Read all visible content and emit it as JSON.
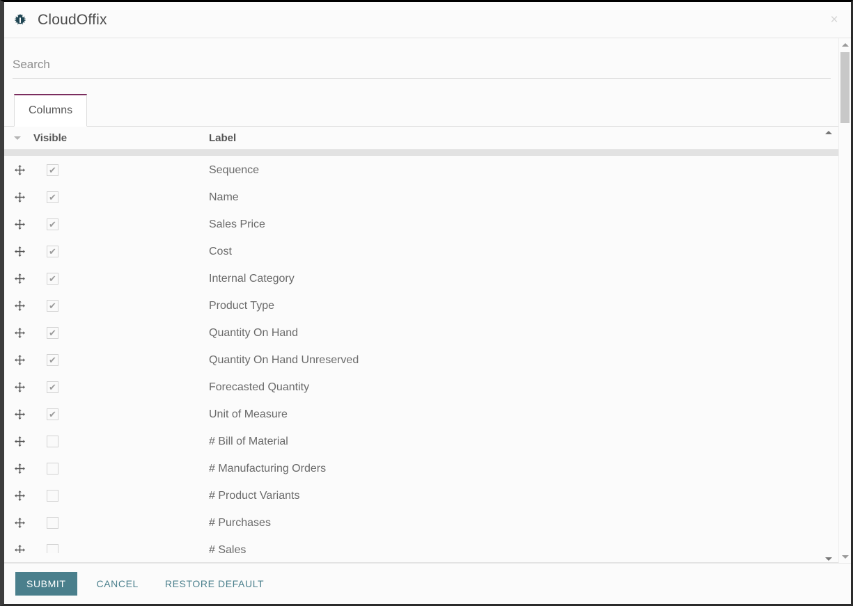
{
  "window": {
    "title": "CloudOffix",
    "icon": "bug-icon",
    "close_label": "×"
  },
  "search": {
    "placeholder": "Search",
    "value": ""
  },
  "tabs": [
    {
      "label": "Columns",
      "active": true
    }
  ],
  "table": {
    "headers": {
      "caret": "chevron-down-icon",
      "visible": "Visible",
      "label": "Label"
    },
    "rows": [
      {
        "visible": true,
        "label": "Sequence"
      },
      {
        "visible": true,
        "label": "Name"
      },
      {
        "visible": true,
        "label": "Sales Price"
      },
      {
        "visible": true,
        "label": "Cost"
      },
      {
        "visible": true,
        "label": "Internal Category"
      },
      {
        "visible": true,
        "label": "Product Type"
      },
      {
        "visible": true,
        "label": "Quantity On Hand"
      },
      {
        "visible": true,
        "label": "Quantity On Hand Unreserved"
      },
      {
        "visible": true,
        "label": "Forecasted Quantity"
      },
      {
        "visible": true,
        "label": "Unit of Measure"
      },
      {
        "visible": false,
        "label": "# Bill of Material"
      },
      {
        "visible": false,
        "label": "# Manufacturing Orders"
      },
      {
        "visible": false,
        "label": "# Product Variants"
      },
      {
        "visible": false,
        "label": "# Purchases"
      },
      {
        "visible": false,
        "label": "# Sales"
      }
    ],
    "checkmark": "✔"
  },
  "footer": {
    "submit_label": "SUBMIT",
    "cancel_label": "CANCEL",
    "restore_label": "RESTORE DEFAULT"
  },
  "colors": {
    "accent_teal": "#4a7f8c",
    "tab_purple": "#7b2d5e",
    "icon_teal": "#1f4552",
    "text_gray": "#6a6a6a",
    "header_gray": "#555555"
  }
}
